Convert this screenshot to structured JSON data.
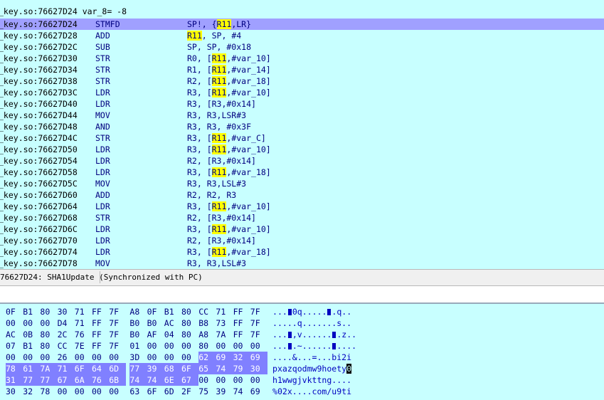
{
  "disasm": {
    "header_line": "_key.so:76627D24 var_8= -8",
    "rows": [
      {
        "addr": "_key.so:76627D24",
        "mn": "STMFD",
        "ops": [
          {
            "t": "SP!, {"
          },
          {
            "t": "R11",
            "hl": true
          },
          {
            "t": ",LR}"
          }
        ],
        "selected": true
      },
      {
        "addr": "_key.so:76627D28",
        "mn": "ADD",
        "ops": [
          {
            "t": "R11",
            "hl": true
          },
          {
            "t": ", SP, #4"
          }
        ]
      },
      {
        "addr": "_key.so:76627D2C",
        "mn": "SUB",
        "ops": [
          {
            "t": "SP, SP, #0x18"
          }
        ]
      },
      {
        "addr": "_key.so:76627D30",
        "mn": "STR",
        "ops": [
          {
            "t": "R0, ["
          },
          {
            "t": "R11",
            "hl": true
          },
          {
            "t": ",#var_10]"
          }
        ]
      },
      {
        "addr": "_key.so:76627D34",
        "mn": "STR",
        "ops": [
          {
            "t": "R1, ["
          },
          {
            "t": "R11",
            "hl": true
          },
          {
            "t": ",#var_14]"
          }
        ]
      },
      {
        "addr": "_key.so:76627D38",
        "mn": "STR",
        "ops": [
          {
            "t": "R2, ["
          },
          {
            "t": "R11",
            "hl": true
          },
          {
            "t": ",#var_18]"
          }
        ]
      },
      {
        "addr": "_key.so:76627D3C",
        "mn": "LDR",
        "ops": [
          {
            "t": "R3, ["
          },
          {
            "t": "R11",
            "hl": true
          },
          {
            "t": ",#var_10]"
          }
        ]
      },
      {
        "addr": "_key.so:76627D40",
        "mn": "LDR",
        "ops": [
          {
            "t": "R3, [R3,#0x14]"
          }
        ]
      },
      {
        "addr": "_key.so:76627D44",
        "mn": "MOV",
        "ops": [
          {
            "t": "R3, R3,LSR#3"
          }
        ]
      },
      {
        "addr": "_key.so:76627D48",
        "mn": "AND",
        "ops": [
          {
            "t": "R3, R3, #0x3F"
          }
        ]
      },
      {
        "addr": "_key.so:76627D4C",
        "mn": "STR",
        "ops": [
          {
            "t": "R3, ["
          },
          {
            "t": "R11",
            "hl": true
          },
          {
            "t": ",#var_C]"
          }
        ]
      },
      {
        "addr": "_key.so:76627D50",
        "mn": "LDR",
        "ops": [
          {
            "t": "R3, ["
          },
          {
            "t": "R11",
            "hl": true
          },
          {
            "t": ",#var_10]"
          }
        ]
      },
      {
        "addr": "_key.so:76627D54",
        "mn": "LDR",
        "ops": [
          {
            "t": "R2, [R3,#0x14]"
          }
        ]
      },
      {
        "addr": "_key.so:76627D58",
        "mn": "LDR",
        "ops": [
          {
            "t": "R3, ["
          },
          {
            "t": "R11",
            "hl": true
          },
          {
            "t": ",#var_18]"
          }
        ]
      },
      {
        "addr": "_key.so:76627D5C",
        "mn": "MOV",
        "ops": [
          {
            "t": "R3, R3,LSL#3"
          }
        ]
      },
      {
        "addr": "_key.so:76627D60",
        "mn": "ADD",
        "ops": [
          {
            "t": "R2, R2, R3"
          }
        ]
      },
      {
        "addr": "_key.so:76627D64",
        "mn": "LDR",
        "ops": [
          {
            "t": "R3, ["
          },
          {
            "t": "R11",
            "hl": true
          },
          {
            "t": ",#var_10]"
          }
        ]
      },
      {
        "addr": "_key.so:76627D68",
        "mn": "STR",
        "ops": [
          {
            "t": "R2, [R3,#0x14]"
          }
        ]
      },
      {
        "addr": "_key.so:76627D6C",
        "mn": "LDR",
        "ops": [
          {
            "t": "R3, ["
          },
          {
            "t": "R11",
            "hl": true
          },
          {
            "t": ",#var_10]"
          }
        ]
      },
      {
        "addr": "_key.so:76627D70",
        "mn": "LDR",
        "ops": [
          {
            "t": "R2, [R3,#0x14]"
          }
        ]
      },
      {
        "addr": "_key.so:76627D74",
        "mn": "LDR",
        "ops": [
          {
            "t": "R3, ["
          },
          {
            "t": "R11",
            "hl": true
          },
          {
            "t": ",#var_18]"
          }
        ]
      },
      {
        "addr": "_key.so:76627D78",
        "mn": "MOV",
        "ops": [
          {
            "t": "R3, R3,LSL#3"
          }
        ]
      }
    ]
  },
  "status": {
    "text": "76627D24: SHA1Update (Synchronized with PC)"
  },
  "hexview": {
    "rows": [
      {
        "bytes": [
          "0F",
          "B1",
          "80",
          "30",
          "71",
          "FF",
          "7F",
          "A8",
          "0F",
          "B1",
          "80",
          "CC",
          "71",
          "FF",
          "7F"
        ],
        "sel": [],
        "ascii": "...■0q.....■.q.."
      },
      {
        "bytes": [
          "00",
          "00",
          "00",
          "D4",
          "71",
          "FF",
          "7F",
          "B0",
          "B0",
          "AC",
          "80",
          "B8",
          "73",
          "FF",
          "7F"
        ],
        "sel": [],
        "ascii": ".....q.......s.."
      },
      {
        "bytes": [
          "AC",
          "0B",
          "80",
          "2C",
          "76",
          "FF",
          "7F",
          "B0",
          "AF",
          "04",
          "80",
          "A8",
          "7A",
          "FF",
          "7F"
        ],
        "sel": [],
        "ascii": "...■,v......■.z.."
      },
      {
        "bytes": [
          "07",
          "B1",
          "80",
          "CC",
          "7E",
          "FF",
          "7F",
          "01",
          "00",
          "00",
          "00",
          "80",
          "00",
          "00",
          "00"
        ],
        "sel": [],
        "ascii": "...■.~......■...."
      },
      {
        "bytes": [
          "00",
          "00",
          "00",
          "26",
          "00",
          "00",
          "00",
          "3D",
          "00",
          "00",
          "00",
          "62",
          "69",
          "32",
          "69"
        ],
        "sel": [
          11,
          12,
          13,
          14
        ],
        "ascii": "....&...=...bi2i"
      },
      {
        "bytes": [
          "78",
          "61",
          "7A",
          "71",
          "6F",
          "64",
          "6D",
          "77",
          "39",
          "68",
          "6F",
          "65",
          "74",
          "79",
          "30"
        ],
        "sel": [
          0,
          1,
          2,
          3,
          4,
          5,
          6,
          7,
          8,
          9,
          10,
          11,
          12,
          13,
          14
        ],
        "ascii": "pxazqodmw9hoety0",
        "cursor_last": true
      },
      {
        "bytes": [
          "31",
          "77",
          "77",
          "67",
          "6A",
          "76",
          "6B",
          "74",
          "74",
          "6E",
          "67",
          "00",
          "00",
          "00",
          "00"
        ],
        "sel": [
          0,
          1,
          2,
          3,
          4,
          5,
          6,
          7,
          8,
          9,
          10
        ],
        "ascii": "h1wwgjvkttng...."
      },
      {
        "bytes": [
          "30",
          "32",
          "78",
          "00",
          "00",
          "00",
          "00",
          "63",
          "6F",
          "6D",
          "2F",
          "75",
          "39",
          "74",
          "69"
        ],
        "sel": [],
        "ascii": "%02x....com/u9ti"
      }
    ]
  }
}
